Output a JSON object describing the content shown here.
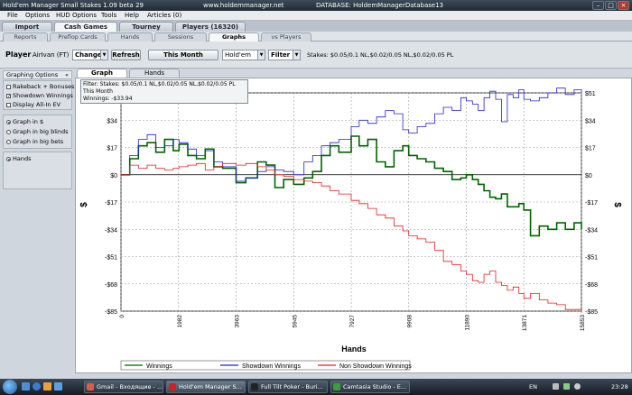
{
  "titlebar": {
    "app_title": "Hold'em Manager Small Stakes 1.09 beta 29",
    "website": "www.holdemmanager.net",
    "database": "DATABASE: HoldemManagerDatabase13"
  },
  "menu": [
    "File",
    "Options",
    "HUD Options",
    "Tools",
    "Help",
    "Articles (0)"
  ],
  "main_tabs": [
    "Import",
    "Cash Games",
    "Tourney",
    "Players (16320)"
  ],
  "sub_tabs": [
    "Reports",
    "Preflop Cards",
    "Hands",
    "Sessions",
    "Graphs",
    "vs Players"
  ],
  "toolbar": {
    "player_label": "Player",
    "player_name": "AirIvan (FT)",
    "change_label": "Change",
    "refresh_label": "Refresh",
    "period_label": "This Month",
    "game_value": "Hold'em",
    "filter_label": "Filter",
    "stakes_text": "Stakes: $0.05/0.1 NL,$0.02/0.05 NL,$0.02/0.05 PL"
  },
  "left_panel": {
    "header": "Graphing Options",
    "collapse_glyph": "«",
    "checkboxes": [
      {
        "label": "Rakeback + Bonuses",
        "checked": false
      },
      {
        "label": "Showdown Winnings",
        "checked": true
      },
      {
        "label": "Display All-In EV",
        "checked": false
      }
    ],
    "radios": [
      {
        "label": "Graph in $",
        "selected": true
      },
      {
        "label": "Graph in big blinds",
        "selected": false
      },
      {
        "label": "Graph in big bets",
        "selected": false
      }
    ],
    "x_axis_options": [
      {
        "label": "Hands",
        "selected": true
      }
    ]
  },
  "graph_tabs": [
    "Graph",
    "Hands"
  ],
  "info_box": {
    "line1": "Filter: Stakes: $0.05/0.1 NL,$0.02/0.05 NL,$0.02/0.05 PL",
    "line2": "This Month",
    "line3": "Winnings: -$33.94"
  },
  "taskbar": {
    "items": [
      "Gmail - Входящие - ...",
      "Hold'em Manager S...",
      "Full Tilt Poker - Buri...",
      "Camtasia Studio - E..."
    ],
    "lang": "EN",
    "clock": "23:28"
  },
  "colors": {
    "winnings": "#006400",
    "showdown": "#2222cc",
    "non_showdown": "#e02020",
    "zero_line": "#000000"
  },
  "chart_data": {
    "type": "line",
    "xlabel": "Hands",
    "ylabel": "$",
    "x_ticks": [
      0,
      1982,
      3963,
      5945,
      7927,
      9908,
      11890,
      13871,
      15853
    ],
    "y_ticks": [
      -85,
      -68,
      -51,
      -34,
      -17,
      0,
      17,
      34,
      51
    ],
    "xlim": [
      0,
      15853
    ],
    "ylim": [
      -85,
      51
    ],
    "grid": true,
    "legend_position": "bottom",
    "series": [
      {
        "name": "Winnings",
        "x": [
          0,
          300,
          600,
          900,
          1200,
          1500,
          1800,
          2000,
          2300,
          2600,
          2900,
          3200,
          3500,
          3963,
          4300,
          4700,
          5000,
          5300,
          5600,
          5945,
          6300,
          6600,
          6900,
          7200,
          7500,
          7927,
          8200,
          8500,
          8800,
          9100,
          9400,
          9700,
          9908,
          10200,
          10500,
          10800,
          11100,
          11400,
          11700,
          11890,
          12100,
          12300,
          12500,
          12700,
          12900,
          13100,
          13300,
          13500,
          13700,
          13871,
          14100,
          14400,
          14700,
          15000,
          15300,
          15600,
          15853
        ],
        "values": [
          0,
          10,
          18,
          20,
          14,
          22,
          15,
          19,
          12,
          10,
          16,
          5,
          4,
          -5,
          -2,
          8,
          6,
          -8,
          -3,
          -6,
          -2,
          2,
          12,
          18,
          14,
          24,
          18,
          22,
          8,
          5,
          15,
          18,
          12,
          10,
          8,
          4,
          2,
          -3,
          -2,
          0,
          -3,
          -6,
          -10,
          -14,
          -15,
          -12,
          -20,
          -20,
          -18,
          -22,
          -38,
          -32,
          -34,
          -30,
          -34,
          -30,
          -33.94
        ]
      },
      {
        "name": "Showdown Winnings",
        "x": [
          0,
          300,
          600,
          900,
          1200,
          1500,
          1800,
          2000,
          2300,
          2600,
          2900,
          3200,
          3500,
          3963,
          4300,
          4700,
          5000,
          5300,
          5600,
          5945,
          6300,
          6600,
          6900,
          7200,
          7500,
          7927,
          8200,
          8500,
          8800,
          9100,
          9400,
          9700,
          9908,
          10200,
          10500,
          10800,
          11100,
          11400,
          11700,
          11890,
          12100,
          12300,
          12500,
          12700,
          12900,
          13100,
          13300,
          13500,
          13700,
          13871,
          14100,
          14400,
          14700,
          15000,
          15300,
          15600,
          15853
        ],
        "values": [
          0,
          12,
          22,
          25,
          17,
          18,
          22,
          20,
          16,
          12,
          15,
          8,
          5,
          -4,
          -2,
          2,
          5,
          3,
          2,
          0,
          8,
          12,
          18,
          20,
          22,
          30,
          34,
          32,
          36,
          40,
          38,
          28,
          26,
          30,
          32,
          38,
          42,
          40,
          48,
          46,
          44,
          40,
          48,
          52,
          47,
          33,
          50,
          48,
          53,
          47,
          46,
          48,
          51,
          54,
          50,
          53,
          51
        ]
      },
      {
        "name": "Non Showdown Winnings",
        "x": [
          0,
          300,
          600,
          900,
          1200,
          1500,
          1800,
          2000,
          2300,
          2600,
          2900,
          3200,
          3500,
          3963,
          4300,
          4700,
          5000,
          5300,
          5600,
          5945,
          6300,
          6600,
          6900,
          7200,
          7500,
          7927,
          8200,
          8500,
          8800,
          9100,
          9400,
          9700,
          9908,
          10200,
          10500,
          10800,
          11100,
          11400,
          11700,
          11890,
          12100,
          12300,
          12500,
          12700,
          12900,
          13100,
          13300,
          13500,
          13700,
          13871,
          14100,
          14400,
          14700,
          15000,
          15300,
          15600,
          15853
        ],
        "values": [
          0,
          6,
          4,
          6,
          4,
          3,
          4,
          5,
          6,
          7,
          3,
          5,
          7,
          6,
          7,
          5,
          3,
          0,
          -1,
          -3,
          -4,
          -5,
          -7,
          -10,
          -12,
          -16,
          -18,
          -21,
          -25,
          -27,
          -32,
          -35,
          -38,
          -40,
          -42,
          -47,
          -54,
          -56,
          -60,
          -62,
          -66,
          -67,
          -62,
          -60,
          -67,
          -69,
          -72,
          -70,
          -74,
          -77,
          -74,
          -78,
          -80,
          -81,
          -84,
          -84,
          -86
        ]
      }
    ]
  }
}
